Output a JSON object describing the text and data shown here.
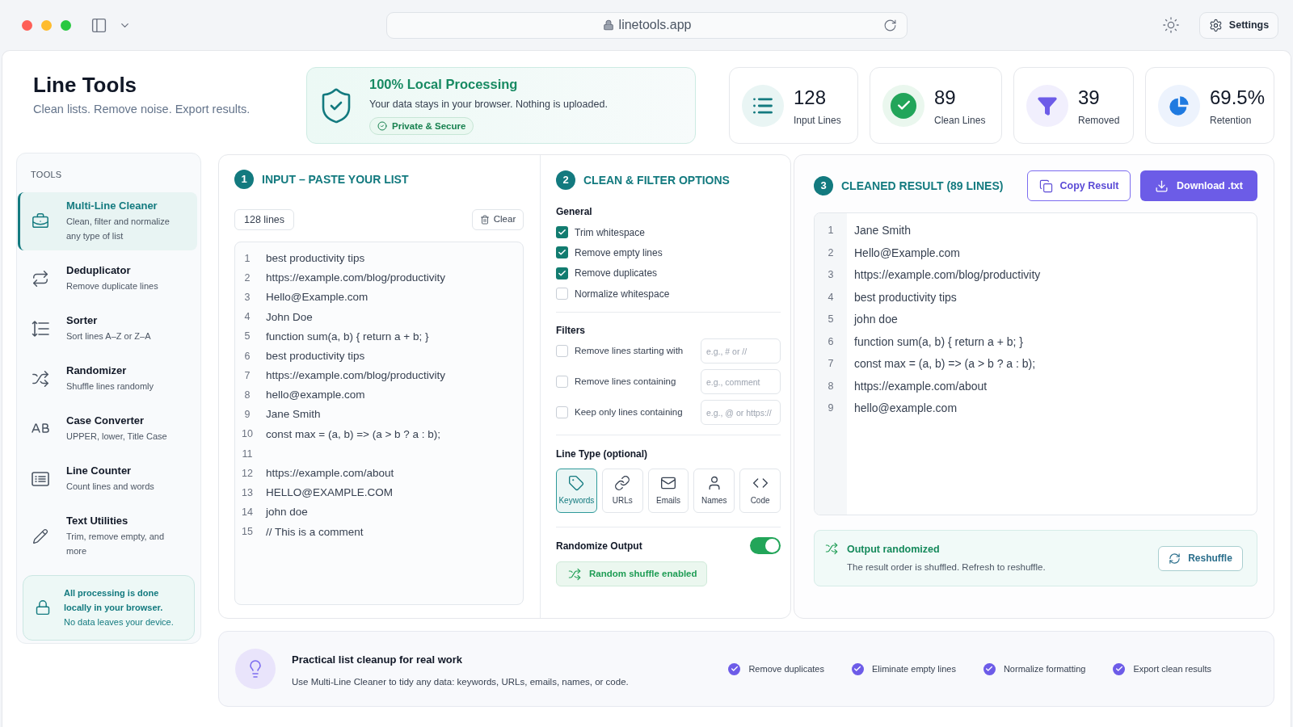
{
  "browser": {
    "url": "linetools.app",
    "settings_label": "Settings"
  },
  "header": {
    "title": "Line Tools",
    "subtitle": "Clean lists. Remove noise. Export results."
  },
  "privacy": {
    "title": "100% Local Processing",
    "text": "Your data stays in your browser. Nothing is uploaded.",
    "badge": "Private & Secure"
  },
  "stats": [
    {
      "value": "128",
      "label": "Input Lines"
    },
    {
      "value": "89",
      "label": "Clean Lines"
    },
    {
      "value": "39",
      "label": "Removed"
    },
    {
      "value": "69.5%",
      "label": "Retention"
    }
  ],
  "sidebar": {
    "heading": "TOOLS",
    "items": [
      {
        "title": "Multi-Line Cleaner",
        "subtitle": "Clean, filter and normalize any type of list",
        "selected": true
      },
      {
        "title": "Deduplicator",
        "subtitle": "Remove duplicate lines",
        "selected": false
      },
      {
        "title": "Sorter",
        "subtitle": "Sort lines A–Z or Z–A",
        "selected": false
      },
      {
        "title": "Randomizer",
        "subtitle": "Shuffle lines randomly",
        "selected": false
      },
      {
        "title": "Case Converter",
        "subtitle": "UPPER, lower, Title Case",
        "selected": false
      },
      {
        "title": "Line Counter",
        "subtitle": "Count lines and words",
        "selected": false
      },
      {
        "title": "Text Utilities",
        "subtitle": "Trim, remove empty, and more",
        "selected": false
      }
    ],
    "note": {
      "title": "All processing is done locally in your browser.",
      "text": "No data leaves your device."
    }
  },
  "input": {
    "step": "1",
    "title": "INPUT – PASTE YOUR LIST",
    "count": "128 lines",
    "clear_label": "Clear",
    "lines": [
      {
        "number": "1",
        "text": "best productivity tips"
      },
      {
        "number": "2",
        "text": "https://example.com/blog/productivity"
      },
      {
        "number": "3",
        "text": "Hello@Example.com"
      },
      {
        "number": "4",
        "text": "John Doe"
      },
      {
        "number": "5",
        "text": "function sum(a, b) { return a + b; }"
      },
      {
        "number": "6",
        "text": "best productivity tips"
      },
      {
        "number": "7",
        "text": "https://example.com/blog/productivity"
      },
      {
        "number": "8",
        "text": "hello@example.com"
      },
      {
        "number": "9",
        "text": "Jane Smith"
      },
      {
        "number": "10",
        "text": "const max = (a, b) => (a > b ? a : b);"
      },
      {
        "number": "11"
      },
      {
        "number": "12",
        "text": "https://example.com/about"
      },
      {
        "number": "13",
        "text": "HELLO@EXAMPLE.COM"
      },
      {
        "number": "14",
        "text": "john doe"
      },
      {
        "number": "15",
        "text": "// This is a comment"
      }
    ]
  },
  "options": {
    "step": "2",
    "title": "CLEAN & FILTER OPTIONS",
    "general": {
      "heading": "General",
      "items": [
        {
          "label": "Trim whitespace",
          "checked": true
        },
        {
          "label": "Remove empty lines",
          "checked": true
        },
        {
          "label": "Remove duplicates",
          "checked": true
        },
        {
          "label": "Normalize whitespace",
          "checked": false
        }
      ]
    },
    "filters": {
      "heading": "Filters",
      "items": [
        {
          "label": "Remove lines starting with",
          "checked": false,
          "placeholder": "e.g., # or //"
        },
        {
          "label": "Remove lines containing",
          "checked": false,
          "placeholder": "e.g., comment"
        },
        {
          "label": "Keep only lines containing",
          "checked": false,
          "placeholder": "e.g., @ or https://"
        }
      ]
    },
    "line_type": {
      "heading": "Line Type (optional)",
      "types": [
        {
          "label": "Keywords",
          "selected": true
        },
        {
          "label": "URLs",
          "selected": false
        },
        {
          "label": "Emails",
          "selected": false
        },
        {
          "label": "Names",
          "selected": false
        },
        {
          "label": "Code",
          "selected": false
        }
      ]
    },
    "randomize": {
      "label": "Randomize Output",
      "on": true,
      "status": "Random shuffle enabled"
    }
  },
  "result": {
    "step": "3",
    "title": "CLEANED RESULT (89 LINES)",
    "copy_label": "Copy Result",
    "download_label": "Download .txt",
    "lines": [
      {
        "number": "1",
        "text": "Jane Smith"
      },
      {
        "number": "2",
        "text": "Hello@Example.com"
      },
      {
        "number": "3",
        "text": "https://example.com/blog/productivity"
      },
      {
        "number": "4",
        "text": "best productivity tips"
      },
      {
        "number": "5",
        "text": "john doe"
      },
      {
        "number": "6",
        "text": "function sum(a, b) { return a + b; }"
      },
      {
        "number": "7",
        "text": "const max = (a, b) => (a > b ? a : b);"
      },
      {
        "number": "8",
        "text": "https://example.com/about"
      },
      {
        "number": "9",
        "text": "hello@example.com"
      }
    ],
    "notice": {
      "title": "Output randomized",
      "text": "The result order is shuffled. Refresh to reshuffle.",
      "button": "Reshuffle"
    }
  },
  "footer": {
    "title": "Practical list cleanup for real work",
    "text": "Use Multi-Line Cleaner to tidy any data: keywords, URLs, emails, names, or code.",
    "features": [
      "Remove duplicates",
      "Eliminate empty lines",
      "Normalize formatting",
      "Export clean results"
    ]
  }
}
